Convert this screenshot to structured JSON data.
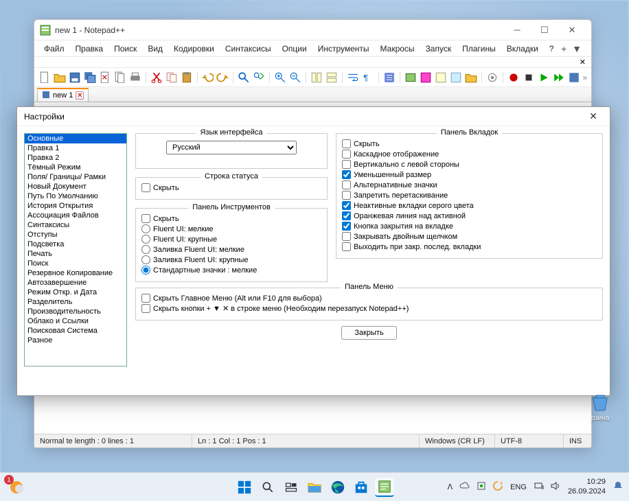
{
  "window": {
    "title": "new 1 - Notepad++",
    "tab_label": "new 1"
  },
  "menubar": {
    "items": [
      "Файл",
      "Правка",
      "Поиск",
      "Вид",
      "Кодировки",
      "Синтаксисы",
      "Опции",
      "Инструменты",
      "Макросы",
      "Запуск",
      "Плагины",
      "Вкладки",
      "?"
    ]
  },
  "statusbar": {
    "lang_info": "Normal te length : 0    lines : 1",
    "position": "Ln : 1   Col : 1   Pos : 1",
    "eol": "Windows (CR LF)",
    "encoding": "UTF-8",
    "ins": "INS"
  },
  "dialog": {
    "title": "Настройки",
    "categories": [
      "Основные",
      "Правка 1",
      "Правка 2",
      "Тёмный Режим",
      "Поля/ Границы/ Рамки",
      "Новый Документ",
      "Путь По Умолчанию",
      "История Открытия",
      "Ассоциация Файлов",
      "Синтаксисы",
      "Отступы",
      "Подсветка",
      "Печать",
      "Поиск",
      "Резервное Копирование",
      "Автозавершение",
      "Режим Откр. и Дата",
      "Разделитель",
      "Производительность",
      "Облако и Ссылки",
      "Поисковая Система",
      "Разное"
    ],
    "selected_index": 0,
    "lang_group": {
      "legend": "Язык интерфейса",
      "selected": "Русский"
    },
    "status_group": {
      "legend": "Строка статуса",
      "hide": "Скрыть"
    },
    "toolbar_group": {
      "legend": "Панель Инструментов",
      "hide": "Скрыть",
      "r1": "Fluent UI: мелкие",
      "r2": "Fluent UI: крупные",
      "r3": "Заливка Fluent UI: мелкие",
      "r4": "Заливка Fluent UI: крупные",
      "r5": "Стандартные значки : мелкие"
    },
    "tabbar_group": {
      "legend": "Панель Вкладок",
      "c1": "Скрыть",
      "c2": "Каскадное отображение",
      "c3": "Вертикально с левой стороны",
      "c4": "Уменьшенный размер",
      "c5": "Альтернативные значки",
      "c6": "Запретить перетаскивание",
      "c7": "Неактивные вкладки серого цвета",
      "c8": "Оранжевая линия над активной",
      "c9": "Кнопка закрытия на вкладке",
      "c10": "Закрывать двойным щелчком",
      "c11": "Выходить при закр. послед. вкладки"
    },
    "menubar_group": {
      "legend": "Панель Меню",
      "c1": "Скрыть Главное Меню (Alt или F10 для выбора)",
      "c2": "Скрыть кнопки + ▼ ✕ в строке меню (Необходим перезапуск Notepad++)"
    },
    "close_button": "Закрыть"
  },
  "taskbar": {
    "lang": "ENG",
    "time": "10:29",
    "date": "26.09.2024",
    "badge": "1"
  },
  "desktop": {
    "recycle": "рзина"
  }
}
